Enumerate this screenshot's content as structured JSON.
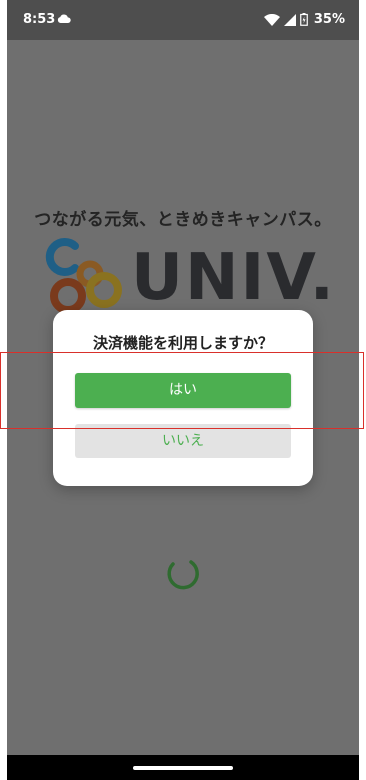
{
  "status_bar": {
    "time": "8:53",
    "battery": "35%",
    "icons": [
      "cloud-icon",
      "wifi-icon",
      "signal-icon",
      "battery-icon"
    ]
  },
  "background": {
    "tagline": "つながる元気、ときめきキャンパス。",
    "logo_text": "UNIV.",
    "logo_ring_colors": [
      "#1f88c4",
      "#f29624",
      "#e0561f",
      "#f2b01f"
    ]
  },
  "dialog": {
    "title": "決済機能を利用しますか？",
    "yes_label": "はい",
    "no_label": "いいえ"
  },
  "colors": {
    "accent_green": "#4caf50",
    "overlay": "#6f6f6f",
    "highlight_red": "#d9302b"
  }
}
